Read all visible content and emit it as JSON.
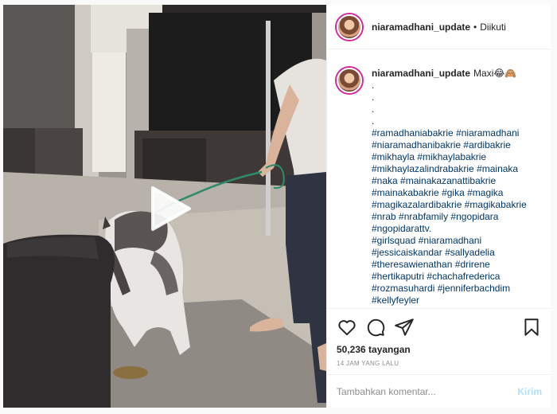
{
  "header": {
    "username": "niaramadhani_update",
    "separator": "•",
    "follow_status": "Diikuti"
  },
  "caption": {
    "username": "niaramadhani_update",
    "text": "Maxi😂🙈",
    "dots": [
      ".",
      ".",
      ".",
      "."
    ],
    "hashtags": [
      "#ramadhaniabakrie",
      "#niaramadhani",
      "#niaramadhanibakrie",
      "#ardibakrie",
      "#mikhayla",
      "#mikhaylabakrie",
      "#mikhaylazalindrabakrie",
      "#mainaka",
      "#naka",
      "#mainakazanattibakrie",
      "#mainakabakrie",
      "#gika",
      "#magika",
      "#magikazalardibakrie",
      "#magikabakrie",
      "#nrab",
      "#nrabfamily",
      "#ngopidara",
      "#ngopidarattv.",
      "#girlsquad",
      "#niaramadhani",
      "#jessicaiskandar",
      "#sallyadelia",
      "#theresawienathan",
      "#drirene",
      "#hertikaputri",
      "#chachafrederica",
      "#rozmasuhardi",
      "#jenniferbachdim",
      "#kellyfeyler"
    ]
  },
  "actions": {
    "like_icon": "heart-icon",
    "comment_icon": "comment-bubble-icon",
    "share_icon": "paper-plane-icon",
    "save_icon": "bookmark-icon",
    "views": "50,236 tayangan",
    "timestamp": "14 JAM YANG LALU"
  },
  "comment_box": {
    "placeholder": "Tambahkan komentar...",
    "send_label": "Kirim"
  },
  "video": {
    "play_icon": "play-icon"
  },
  "colors": {
    "hashtag": "#00376b",
    "send_disabled": "#b2dffc",
    "muted": "#8e8e8e",
    "avatar_ring": "#d6249f"
  }
}
